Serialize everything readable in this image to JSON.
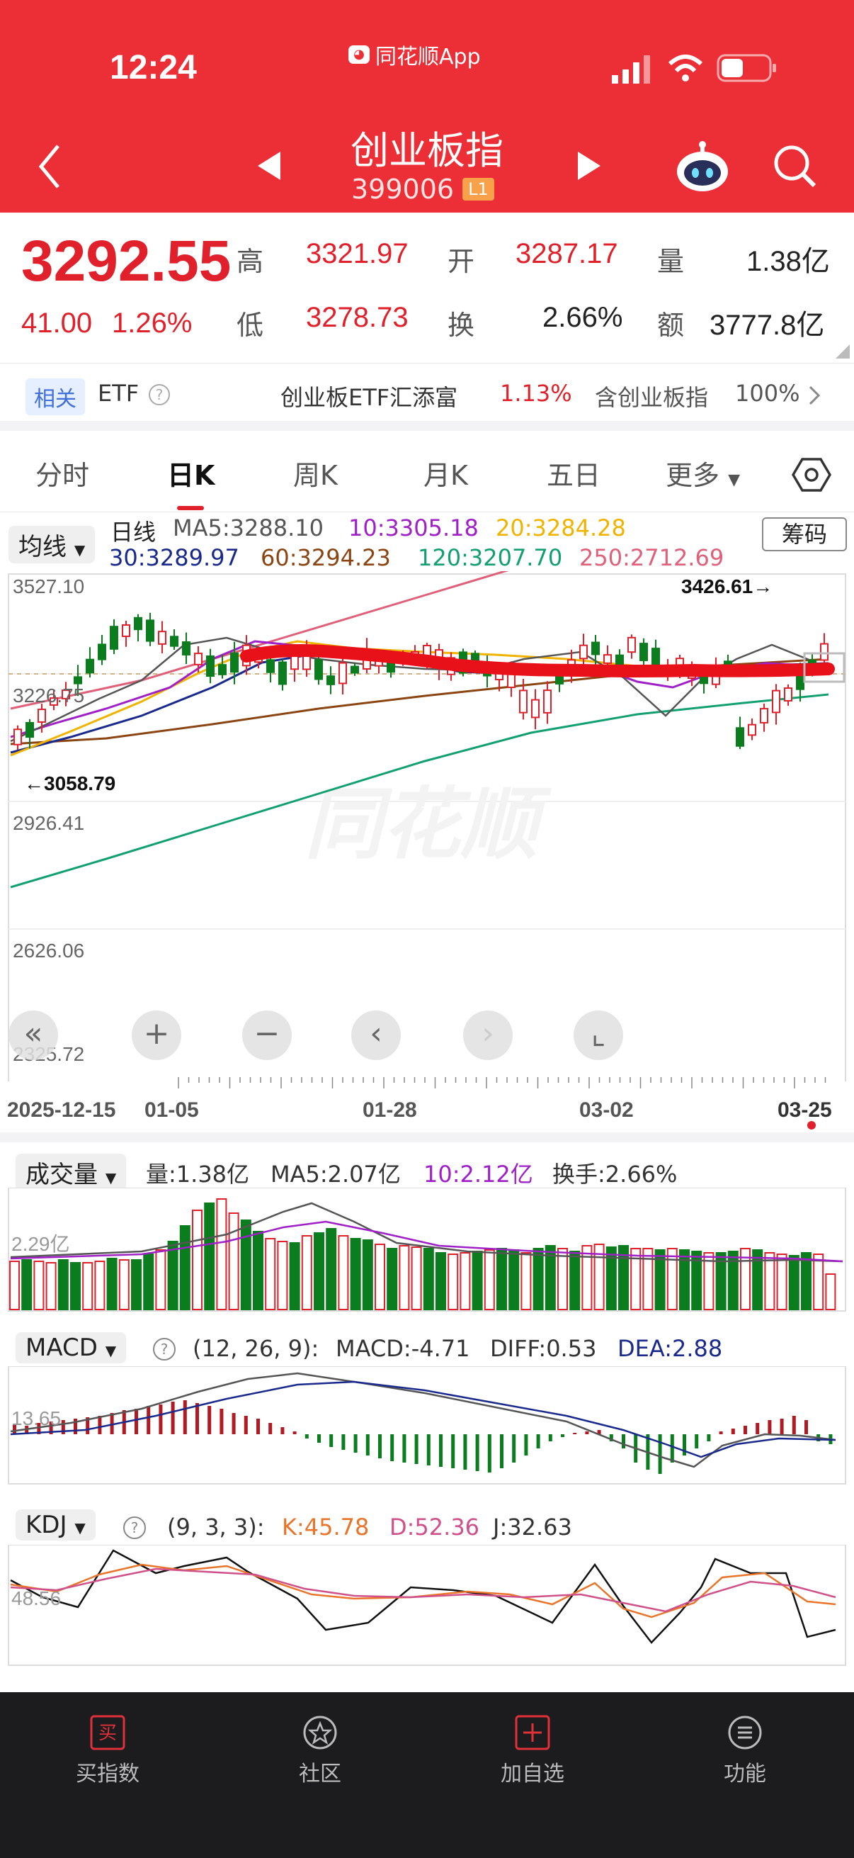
{
  "status_bar": {
    "time": "12:24",
    "app_name": "同花顺App"
  },
  "header": {
    "title": "创业板指",
    "code": "399006",
    "level_badge": "L1"
  },
  "quote": {
    "price": "3292.55",
    "change": "41.00",
    "change_pct": "1.26%",
    "high_label": "高",
    "high": "3321.97",
    "low_label": "低",
    "low": "3278.73",
    "open_label": "开",
    "open": "3287.17",
    "turnover_label": "换",
    "turnover": "2.66%",
    "volume_label": "量",
    "volume": "1.38亿",
    "amount_label": "额",
    "amount": "3777.8亿"
  },
  "etf": {
    "tag": "相关",
    "label": "ETF",
    "fund_name": "创业板ETF汇添富",
    "fund_change": "1.13%",
    "holding_label": "含创业板指",
    "holding_pct": "100%"
  },
  "tabs": [
    "分时",
    "日K",
    "周K",
    "月K",
    "五日",
    "更多"
  ],
  "kline": {
    "ma_selector": "均线",
    "period_label": "日线",
    "chip_button": "筹码",
    "ma5": "MA5:3288.10",
    "ma10": "10:3305.18",
    "ma20": "20:3284.28",
    "ma30": "30:3289.97",
    "ma60": "60:3294.23",
    "ma120": "120:3207.70",
    "ma250": "250:2712.69",
    "y_ticks": [
      "3527.10",
      "3226.75",
      "2926.41",
      "2626.06",
      "2325.72"
    ],
    "high_marker": "3426.61→",
    "low_marker": "←3058.79",
    "watermark": "同花顺",
    "x_ticks": [
      "2025-12-15",
      "01-05",
      "01-28",
      "03-02",
      "03-25"
    ]
  },
  "volume": {
    "selector": "成交量",
    "vol": "量:1.38亿",
    "ma5": "MA5:2.07亿",
    "ma10": "10:2.12亿",
    "turnover": "换手:2.66%",
    "axis": "2.29亿"
  },
  "macd": {
    "selector": "MACD",
    "params": "(12, 26, 9):",
    "macd": "MACD:-4.71",
    "diff": "DIFF:0.53",
    "dea": "DEA:2.88",
    "axis": "13.65"
  },
  "kdj": {
    "selector": "KDJ",
    "params": "(9, 3, 3):",
    "k": "K:45.78",
    "d": "D:52.36",
    "j": "J:32.63",
    "axis": "48.56"
  },
  "colors": {
    "up": "#e0202a",
    "down": "#0b7d1e",
    "ma5": "#555555",
    "ma10": "#a020c8",
    "ma20": "#f0b400",
    "ma30": "#1a2a8c",
    "ma60": "#8b4513",
    "ma120": "#12a070",
    "ma250": "#e0607a"
  },
  "bottom_nav": [
    "买指数",
    "社区",
    "加自选",
    "功能"
  ]
}
